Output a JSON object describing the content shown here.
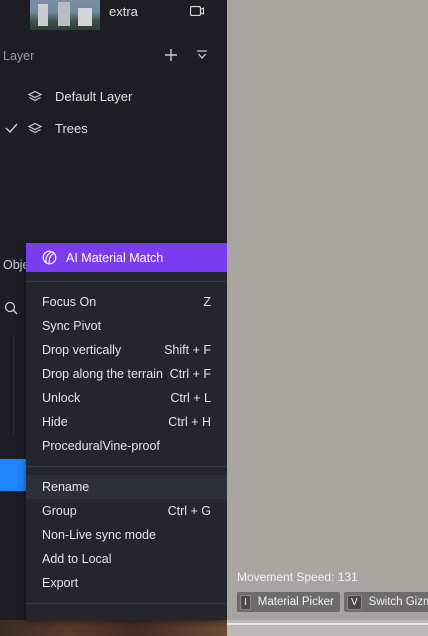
{
  "layers_panel": {
    "top_item_label": "extra",
    "title": "Layer",
    "layers": [
      {
        "label": "Default Layer",
        "checked": false
      },
      {
        "label": "Trees",
        "checked": true
      }
    ]
  },
  "objects_panel": {
    "title_partial": "Obje"
  },
  "context_menu": {
    "ai_item": "AI Material Match",
    "groups": [
      [
        {
          "label": "Focus On",
          "shortcut": "Z"
        },
        {
          "label": "Sync Pivot",
          "shortcut": ""
        },
        {
          "label": "Drop vertically",
          "shortcut": "Shift + F"
        },
        {
          "label": "Drop along the terrain",
          "shortcut": "Ctrl + F"
        },
        {
          "label": "Unlock",
          "shortcut": "Ctrl + L"
        },
        {
          "label": "Hide",
          "shortcut": "Ctrl + H"
        },
        {
          "label": "ProceduralVine-proof",
          "shortcut": ""
        }
      ],
      [
        {
          "label": "Rename",
          "shortcut": "",
          "highlighted": true
        },
        {
          "label": "Group",
          "shortcut": "Ctrl + G"
        },
        {
          "label": "Non-Live sync mode",
          "shortcut": ""
        },
        {
          "label": "Add to Local",
          "shortcut": ""
        },
        {
          "label": "Export",
          "shortcut": ""
        }
      ]
    ]
  },
  "viewport": {
    "movement_speed": "Movement Speed: 131",
    "hints": [
      {
        "key": "I",
        "label": "Material Picker"
      },
      {
        "key": "V",
        "label": "Switch Gizmo"
      }
    ]
  },
  "colors": {
    "accent_purple": "#7b3cf0",
    "selection_blue": "#1e86ff",
    "panel_bg": "#1c1e23",
    "menu_bg": "#23262c",
    "viewport_bg": "#a8a5a0"
  }
}
